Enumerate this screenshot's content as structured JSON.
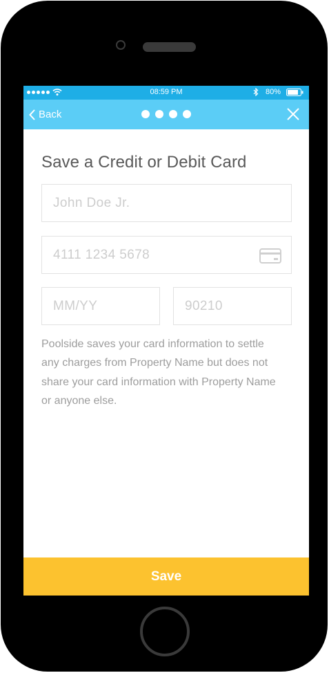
{
  "status_bar": {
    "time": "08:59 PM",
    "battery": "80%"
  },
  "nav": {
    "back_label": "Back",
    "step_dots": 4
  },
  "form": {
    "title": "Save a Credit or Debit Card",
    "name_placeholder": "John Doe Jr.",
    "card_number_placeholder": "4111 1234 5678",
    "expiry_placeholder": "MM/YY",
    "zip_placeholder": "90210"
  },
  "disclaimer": "Poolside saves your card information to settle any charges from Property Name but does not share your card information with Property Name or anyone else.",
  "save_label": "Save",
  "colors": {
    "status_bar": "#1eaee6",
    "nav_bar": "#5bcdf6",
    "save_button": "#fcc22f",
    "title_text": "#595959",
    "body_text": "#9d9d9d"
  }
}
